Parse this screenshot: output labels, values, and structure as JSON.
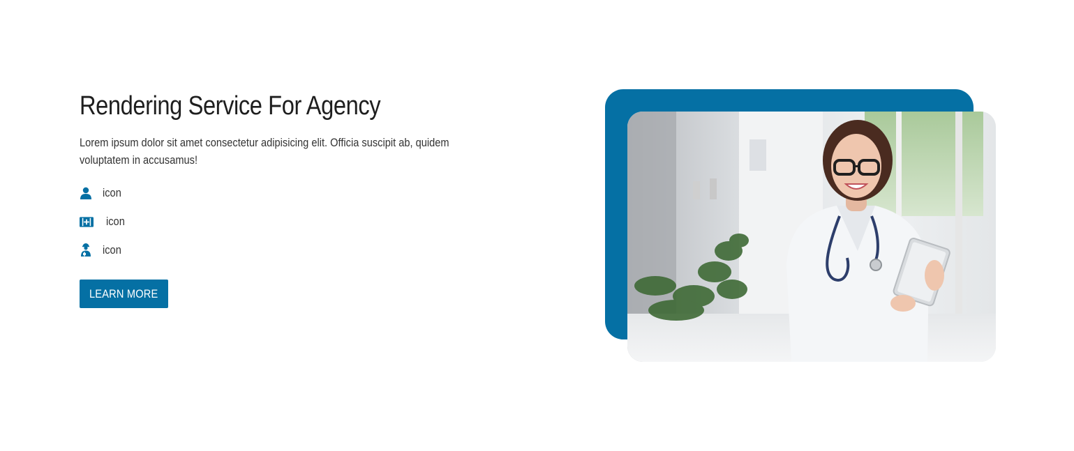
{
  "hero": {
    "title": "Rendering Service For Agency",
    "description": "Lorem ipsum dolor sit amet consectetur adipisicing elit. Officia suscipit ab, quidem voluptatem in accusamus!",
    "features": [
      {
        "icon": "user-icon",
        "label": "icon"
      },
      {
        "icon": "medkit-icon",
        "label": "icon"
      },
      {
        "icon": "user-injured-icon",
        "label": "icon"
      }
    ],
    "button_label": "LEARN MORE"
  },
  "colors": {
    "accent": "#0570a4",
    "text": "#1e1e1e"
  }
}
